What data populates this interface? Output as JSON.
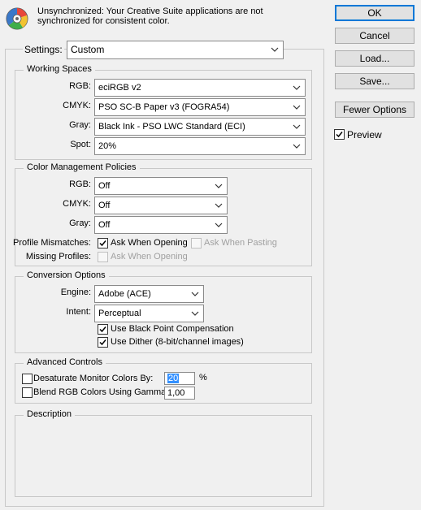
{
  "header": {
    "message_line1": "Unsynchronized: Your Creative Suite applications are not",
    "message_line2": "synchronized for consistent color."
  },
  "settings": {
    "label": "Settings:",
    "value": "Custom"
  },
  "working_spaces": {
    "legend": "Working Spaces",
    "rgb_label": "RGB:",
    "rgb_value": "eciRGB v2",
    "cmyk_label": "CMYK:",
    "cmyk_value": "PSO SC-B Paper v3 (FOGRA54)",
    "gray_label": "Gray:",
    "gray_value": "Black Ink - PSO LWC Standard (ECI)",
    "spot_label": "Spot:",
    "spot_value": "20%"
  },
  "policies": {
    "legend": "Color Management Policies",
    "rgb_label": "RGB:",
    "rgb_value": "Off",
    "cmyk_label": "CMYK:",
    "cmyk_value": "Off",
    "gray_label": "Gray:",
    "gray_value": "Off",
    "mismatch_label": "Profile Mismatches:",
    "ask_opening_label": "Ask When Opening",
    "ask_pasting_label": "Ask When Pasting",
    "missing_label": "Missing Profiles:",
    "missing_ask_label": "Ask When Opening"
  },
  "conversion": {
    "legend": "Conversion Options",
    "engine_label": "Engine:",
    "engine_value": "Adobe (ACE)",
    "intent_label": "Intent:",
    "intent_value": "Perceptual",
    "bpc_label": "Use Black Point Compensation",
    "dither_label": "Use Dither (8-bit/channel images)"
  },
  "advanced": {
    "legend": "Advanced Controls",
    "desat_label": "Desaturate Monitor Colors By:",
    "desat_value": "20",
    "desat_unit": "%",
    "gamma_label": "Blend RGB Colors Using Gamma:",
    "gamma_value": "1,00"
  },
  "description": {
    "legend": "Description"
  },
  "buttons": {
    "ok": "OK",
    "cancel": "Cancel",
    "load": "Load...",
    "save": "Save...",
    "fewer": "Fewer Options",
    "preview": "Preview"
  }
}
